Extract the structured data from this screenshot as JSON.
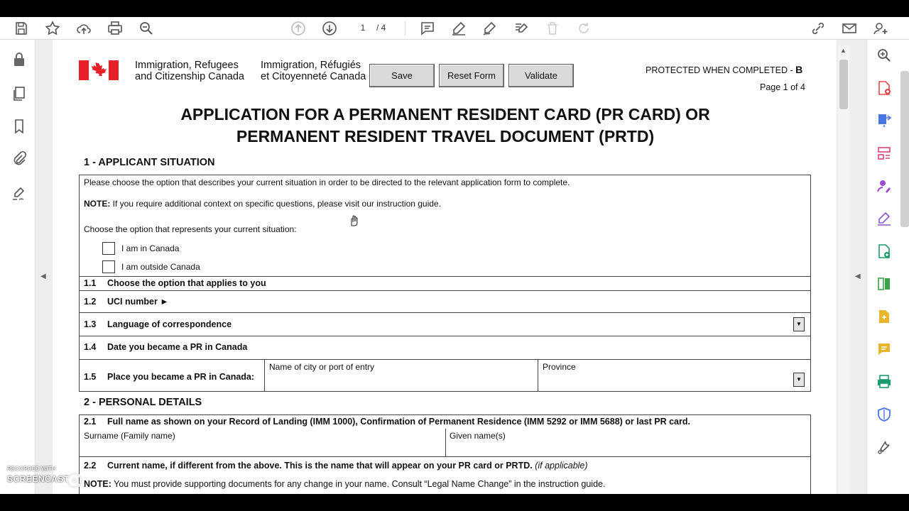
{
  "toolbar": {
    "current_page": "1",
    "total_pages": "/ 4"
  },
  "header": {
    "dept_en_line1": "Immigration, Refugees",
    "dept_en_line2": "and Citizenship Canada",
    "dept_fr_line1": "Immigration, Réfugiés",
    "dept_fr_line2": "et Citoyenneté Canada",
    "save_label": "Save",
    "reset_label": "Reset Form",
    "validate_label": "Validate",
    "protected_text": "PROTECTED WHEN COMPLETED - ",
    "protected_letter": "B",
    "page_of": "Page 1 of 4"
  },
  "form": {
    "title_line1": "APPLICATION FOR A PERMANENT RESIDENT CARD (PR CARD) OR",
    "title_line2": "PERMANENT RESIDENT TRAVEL DOCUMENT (PRTD)",
    "section1": {
      "heading": "1 - APPLICANT SITUATION",
      "intro": "Please choose the option that describes your current situation in order to be directed to the relevant application form to complete.",
      "note_label": "NOTE:",
      "note_text": " If you require additional context on specific questions, please visit our instruction guide.",
      "choose_text": "Choose the option that represents your current situation:",
      "option_canada": "I am in Canada",
      "option_outside": "I am outside Canada",
      "q1_1_num": "1.1",
      "q1_1": "Choose the option that applies to you",
      "q1_2_num": "1.2",
      "q1_2": "UCI number ►",
      "q1_3_num": "1.3",
      "q1_3": "Language of correspondence",
      "q1_4_num": "1.4",
      "q1_4": "Date you became a PR in Canada",
      "q1_5_num": "1.5",
      "q1_5": "Place you became a PR in Canada:",
      "city_label": "Name of city or port of entry",
      "province_label": "Province"
    },
    "section2": {
      "heading": "2 - PERSONAL DETAILS",
      "q2_1_num": "2.1",
      "q2_1": "Full name as shown on your Record of Landing (IMM 1000), Confirmation of Permanent Residence (IMM 5292 or IMM 5688) or last PR card.",
      "surname_label": "Surname (Family name)",
      "given_label": "Given name(s)",
      "q2_2_num": "2.2",
      "q2_2": "Current name, if different from the above. This is the name that will appear on your PR card or PRTD.",
      "q2_2_extra": "(if applicable)",
      "note2_label": "NOTE:",
      "note2_text": " You must provide supporting documents for any change in your name. Consult “Legal Name Change” in the instruction guide."
    }
  },
  "watermark": {
    "line1": "RECORDED WITH",
    "line2": "SCREENCAST"
  },
  "colors": {
    "flag_red": "#e8202a",
    "button_gray": "#d9d9d9"
  }
}
